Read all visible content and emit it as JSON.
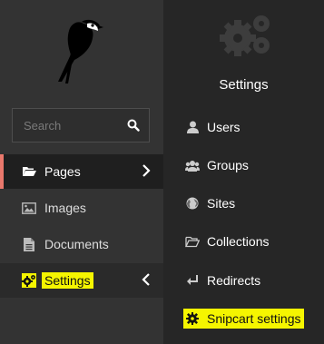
{
  "sidebar": {
    "search": {
      "placeholder": "Search"
    },
    "items": [
      {
        "label": "Pages",
        "icon": "folder-open-icon",
        "active": true,
        "chevron": "chevron-right-icon"
      },
      {
        "label": "Images",
        "icon": "image-icon"
      },
      {
        "label": "Documents",
        "icon": "document-icon"
      },
      {
        "label": "Settings",
        "icon": "cogs-icon",
        "chevron": "chevron-left-icon",
        "highlighted": true
      }
    ]
  },
  "submenu": {
    "title": "Settings",
    "items": [
      {
        "label": "Users",
        "icon": "user-icon"
      },
      {
        "label": "Groups",
        "icon": "group-icon"
      },
      {
        "label": "Sites",
        "icon": "globe-icon"
      },
      {
        "label": "Collections",
        "icon": "folder-open-icon"
      },
      {
        "label": "Redirects",
        "icon": "redirect-icon"
      },
      {
        "label": "Snipcart settings",
        "icon": "cog-icon",
        "highlighted": true
      }
    ]
  },
  "colors": {
    "sidebar_bg": "#333333",
    "submenu_bg": "#262626",
    "active_accent": "#e9786c",
    "highlight": "#f5f500"
  }
}
